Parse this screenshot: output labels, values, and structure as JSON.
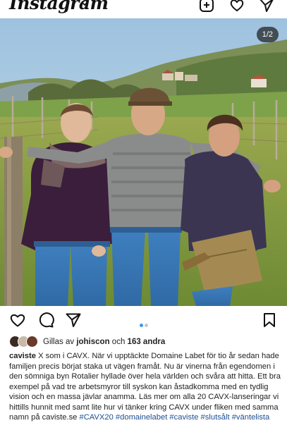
{
  "header": {
    "logo_text": "Instagram"
  },
  "photo": {
    "counter": "1/2",
    "current_slide": 1,
    "total_slides": 2
  },
  "actions": {
    "like_icon": "heart-icon",
    "comment_icon": "comment-icon",
    "share_icon": "send-icon",
    "save_icon": "bookmark-icon"
  },
  "likes": {
    "prefix": "Gillas av",
    "user": "johiscon",
    "middle": "och",
    "others": "163 andra"
  },
  "caption": {
    "username": "caviste",
    "text": "X som i CAVX. När vi upptäckte Domaine Labet för tio år sedan hade familjen precis börjat staka ut vägen framåt. Nu är vinerna från egendomen i den sömniga byn Rotalier hyllade över hela världen och svåra att hitta. Ett bra exempel på vad tre arbetsmyror till syskon kan åstadkomma med en tydlig vision och en massa jävlar anamma. Läs mer om alla 20 CAVX-lanseringar vi hittills hunnit med samt lite hur vi tänker kring CAVX under fliken med samma namn på caviste.se",
    "hashtags": "#CAVX20 #domainelabet #caviste #slutsålt #väntelista"
  },
  "colors": {
    "accent_dot": "#3897f0",
    "inactive_dot": "#c7c7c7",
    "hashtag": "#1d4f91"
  }
}
